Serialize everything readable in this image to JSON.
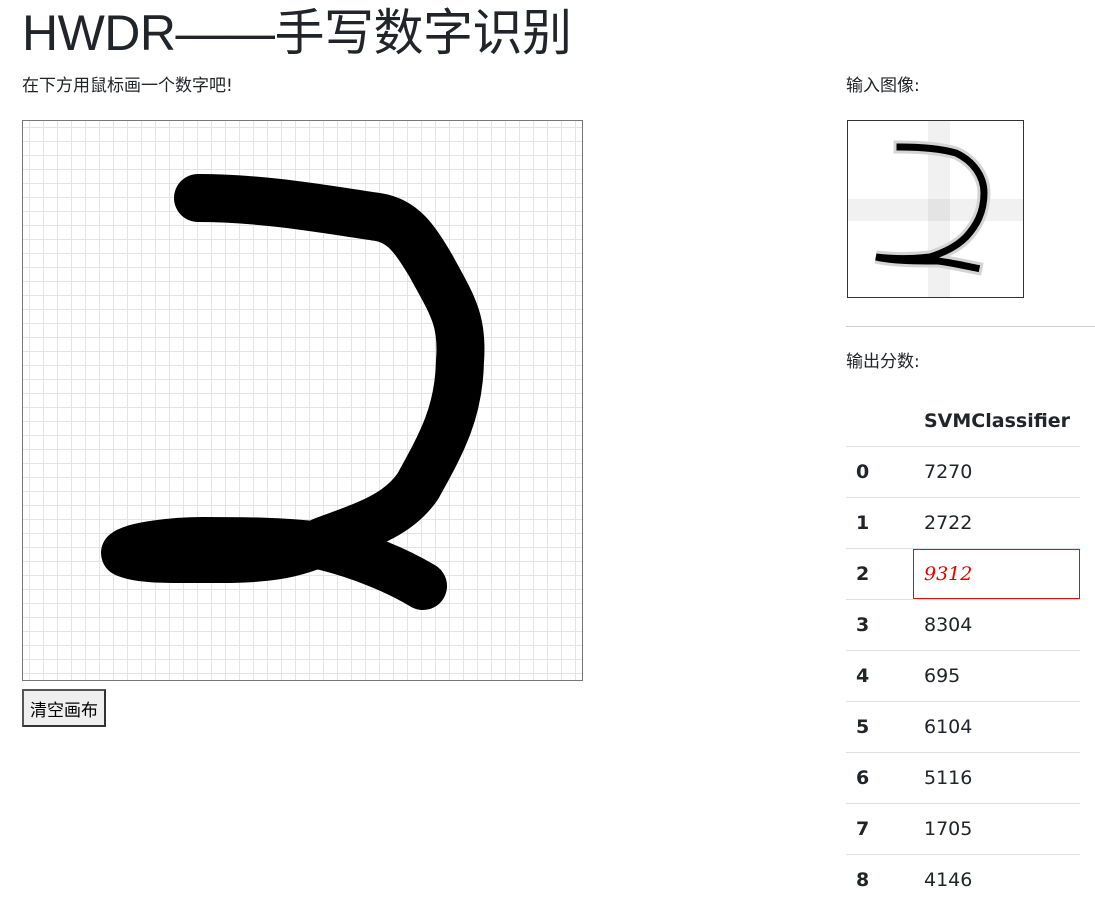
{
  "page": {
    "title": "HWDR——手写数字识别",
    "instruction": "在下方用鼠标画一个数字吧!"
  },
  "canvas": {
    "clear_button_label": "清空画布"
  },
  "right_panel": {
    "input_label": "输入图像:",
    "output_label": "输出分数:"
  },
  "scores": {
    "column_header": "SVMClassifier",
    "highlight_color": "#e00000",
    "rows": [
      {
        "digit": "0",
        "score": "7270"
      },
      {
        "digit": "1",
        "score": "2722"
      },
      {
        "digit": "2",
        "score": "9312"
      },
      {
        "digit": "3",
        "score": "8304"
      },
      {
        "digit": "4",
        "score": "695"
      },
      {
        "digit": "5",
        "score": "6104"
      },
      {
        "digit": "6",
        "score": "5116"
      },
      {
        "digit": "7",
        "score": "1705"
      },
      {
        "digit": "8",
        "score": "4146"
      }
    ]
  }
}
